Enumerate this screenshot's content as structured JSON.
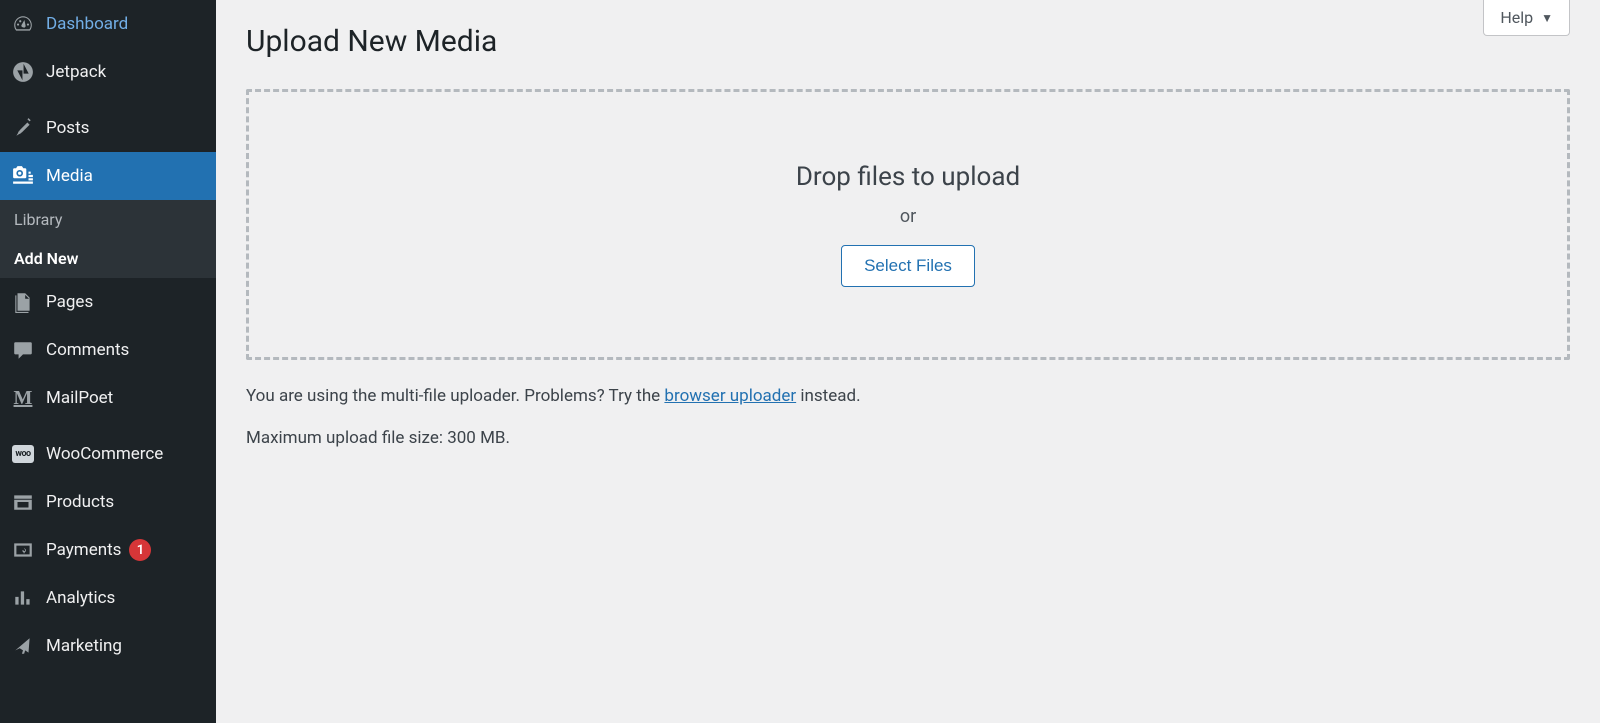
{
  "sidebar": {
    "dashboard": "Dashboard",
    "jetpack": "Jetpack",
    "posts": "Posts",
    "media": "Media",
    "media_sub": {
      "library": "Library",
      "add_new": "Add New"
    },
    "pages": "Pages",
    "comments": "Comments",
    "mailpoet": "MailPoet",
    "woocommerce": "WooCommerce",
    "products": "Products",
    "payments": "Payments",
    "payments_badge": "1",
    "analytics": "Analytics",
    "marketing": "Marketing"
  },
  "help": {
    "label": "Help"
  },
  "page": {
    "title": "Upload New Media",
    "drop_heading": "Drop files to upload",
    "drop_or": "or",
    "select_files": "Select Files",
    "hint_before": "You are using the multi-file uploader. Problems? Try the ",
    "hint_link": "browser uploader",
    "hint_after": " instead.",
    "max_size": "Maximum upload file size: 300 MB."
  }
}
